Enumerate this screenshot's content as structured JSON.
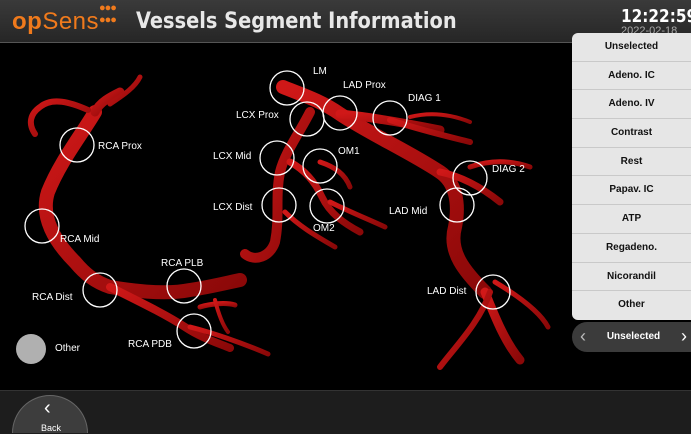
{
  "header": {
    "logo_op": "op",
    "logo_sens": "Sens",
    "title": "Vessels Segment Information",
    "time": "12:22:59",
    "date": "2022-02-18"
  },
  "segments": {
    "lm": "LM",
    "lad_prox": "LAD Prox",
    "diag1": "DIAG 1",
    "lcx_prox": "LCX Prox",
    "lcx_mid": "LCX Mid",
    "om1": "OM1",
    "diag2": "DIAG 2",
    "lad_mid": "LAD Mid",
    "lcx_dist": "LCX Dist",
    "om2": "OM2",
    "rca_prox": "RCA Prox",
    "rca_mid": "RCA Mid",
    "rca_plb": "RCA PLB",
    "rca_dist": "RCA Dist",
    "rca_pdb": "RCA PDB",
    "lad_dist": "LAD Dist"
  },
  "legend": {
    "other": "Other"
  },
  "menu": {
    "items": [
      "Unselected",
      "Adeno. IC",
      "Adeno. IV",
      "Contrast",
      "Rest",
      "Papav. IC",
      "ATP",
      "Regadeno.",
      "Nicorandil",
      "Other"
    ]
  },
  "selector": {
    "value": "Unselected",
    "prev_icon": "chevron-left-icon",
    "next_icon": "chevron-right-icon"
  },
  "footer": {
    "back_label": "Back",
    "back_icon": "chevron-left-icon"
  },
  "colors": {
    "brand": "#f07a1c",
    "vessel": "#b01010",
    "menu_bg": "#e6e6e6"
  }
}
